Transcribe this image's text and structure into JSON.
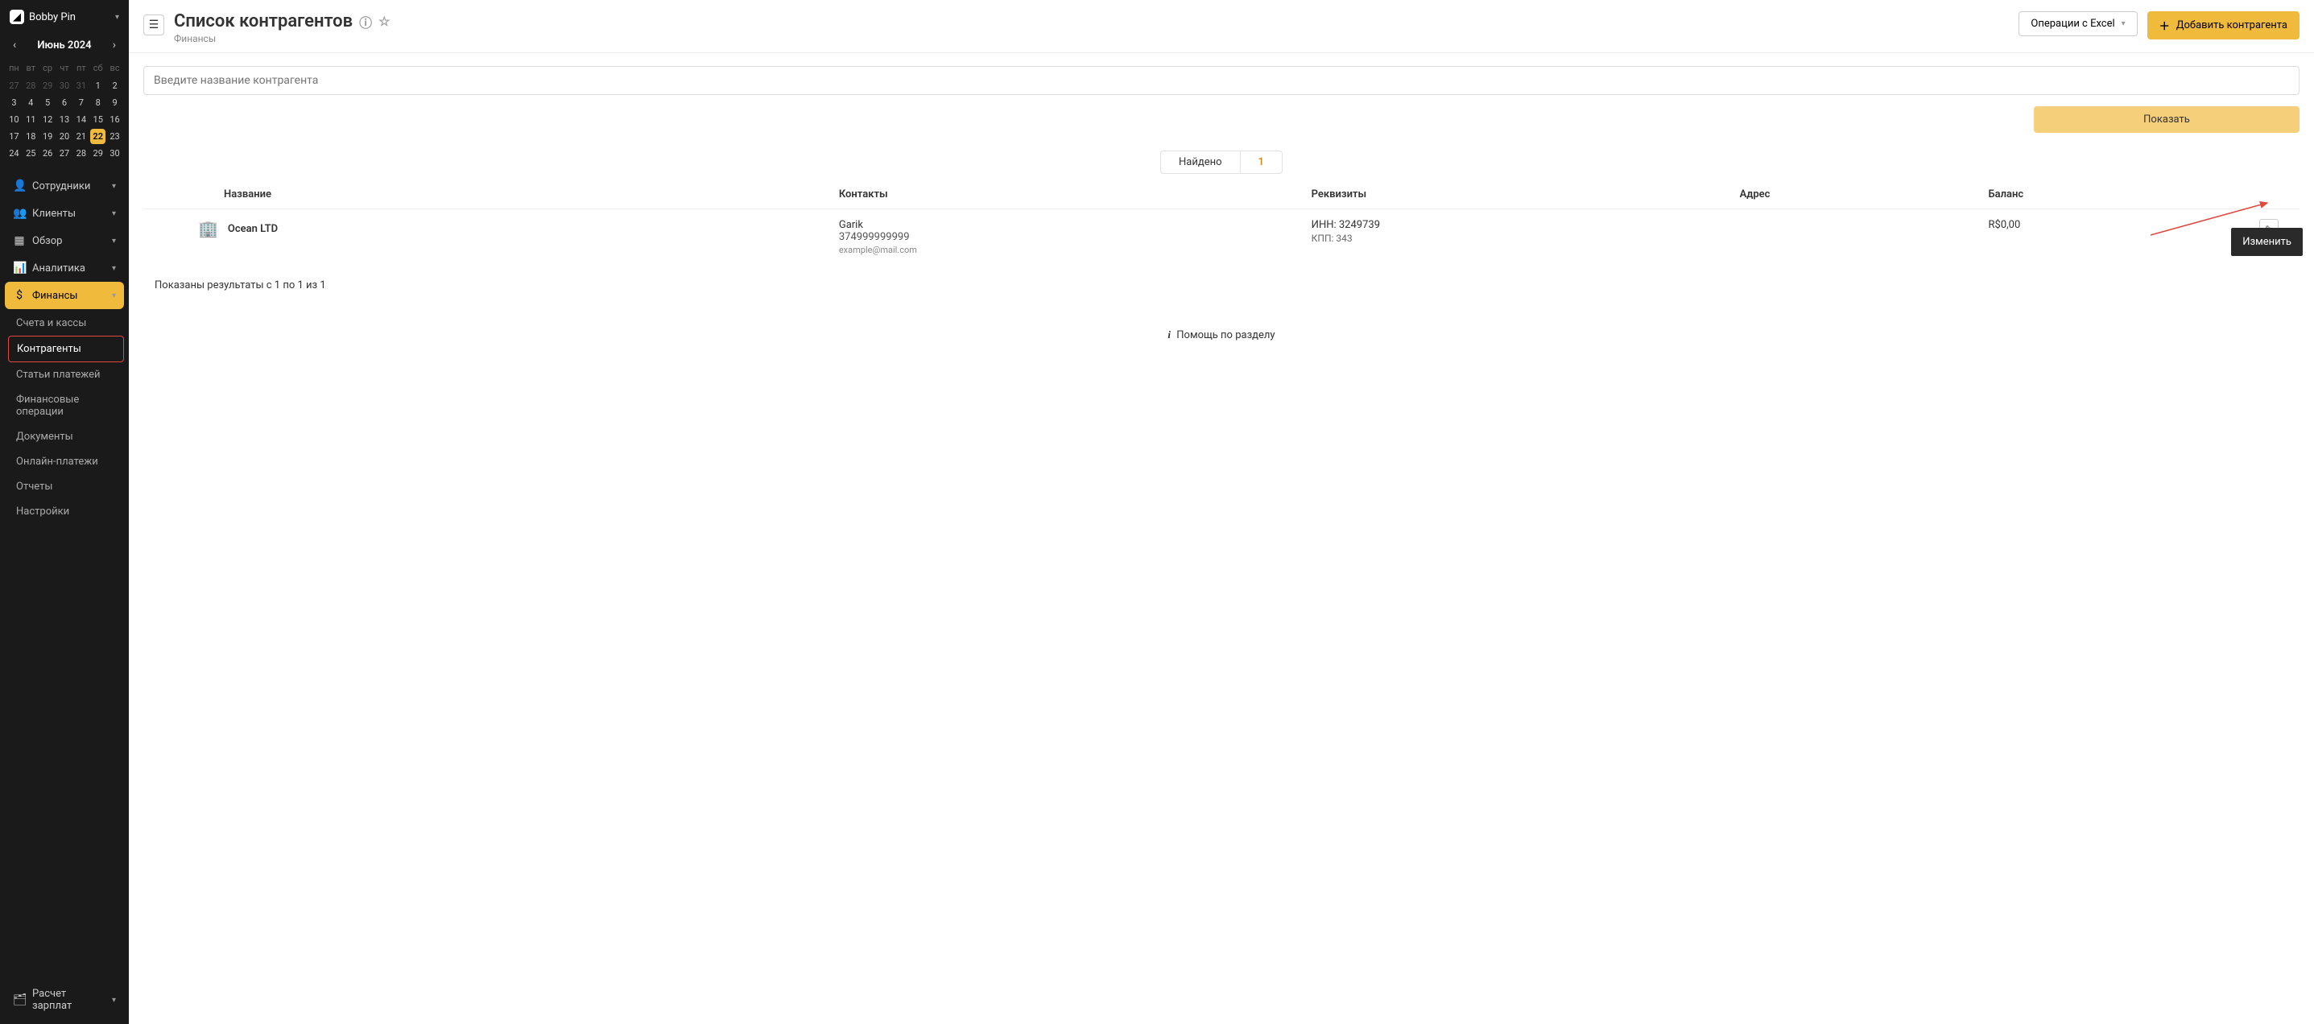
{
  "brand": {
    "name": "Bobby Pin",
    "logo_glyph": "◢"
  },
  "calendar": {
    "month_label": "Июнь 2024",
    "dow": [
      "пн",
      "вт",
      "ср",
      "чт",
      "пт",
      "сб",
      "вс"
    ],
    "weeks": [
      [
        {
          "n": "27",
          "m": true
        },
        {
          "n": "28",
          "m": true
        },
        {
          "n": "29",
          "m": true
        },
        {
          "n": "30",
          "m": true
        },
        {
          "n": "31",
          "m": true
        },
        {
          "n": "1"
        },
        {
          "n": "2"
        }
      ],
      [
        {
          "n": "3"
        },
        {
          "n": "4"
        },
        {
          "n": "5"
        },
        {
          "n": "6"
        },
        {
          "n": "7"
        },
        {
          "n": "8"
        },
        {
          "n": "9"
        }
      ],
      [
        {
          "n": "10"
        },
        {
          "n": "11"
        },
        {
          "n": "12"
        },
        {
          "n": "13"
        },
        {
          "n": "14"
        },
        {
          "n": "15"
        },
        {
          "n": "16"
        }
      ],
      [
        {
          "n": "17"
        },
        {
          "n": "18"
        },
        {
          "n": "19"
        },
        {
          "n": "20"
        },
        {
          "n": "21"
        },
        {
          "n": "22",
          "sel": true
        },
        {
          "n": "23"
        }
      ],
      [
        {
          "n": "24"
        },
        {
          "n": "25"
        },
        {
          "n": "26"
        },
        {
          "n": "27"
        },
        {
          "n": "28"
        },
        {
          "n": "29"
        },
        {
          "n": "30"
        }
      ]
    ]
  },
  "nav": {
    "items": [
      "Сотрудники",
      "Клиенты",
      "Обзор",
      "Аналитика",
      "Финансы",
      "Расчет зарплат"
    ],
    "icons": [
      "👤",
      "👥",
      "▦",
      "📊",
      "$",
      "🗂"
    ],
    "active_index": 4,
    "sub_finance": [
      "Счета и кассы",
      "Контрагенты",
      "Статьи платежей",
      "Финансовые операции",
      "Документы",
      "Онлайн-платежи",
      "Отчеты",
      "Настройки"
    ],
    "sub_highlight_index": 1
  },
  "header": {
    "title": "Список контрагентов",
    "breadcrumb": "Финансы",
    "excel_btn": "Операции с Excel",
    "add_btn": "Добавить контрагента"
  },
  "search": {
    "placeholder": "Введите название контрагента",
    "show_btn": "Показать"
  },
  "found": {
    "label": "Найдено",
    "count": "1"
  },
  "table": {
    "cols": [
      "Название",
      "Контакты",
      "Реквизиты",
      "Адрес",
      "Баланс"
    ],
    "row": {
      "name": "Ocean LTD",
      "contact_name": "Garik",
      "contact_phone": "374999999999",
      "contact_email": "example@mail.com",
      "inn": "ИНН: 3249739",
      "kpp": "КПП: 343",
      "address": "",
      "balance": "R$0,00"
    }
  },
  "pager": {
    "text": "Показаны результаты с 1 по 1 из 1"
  },
  "help": {
    "text": "Помощь по разделу"
  },
  "tooltip": {
    "edit": "Изменить"
  }
}
